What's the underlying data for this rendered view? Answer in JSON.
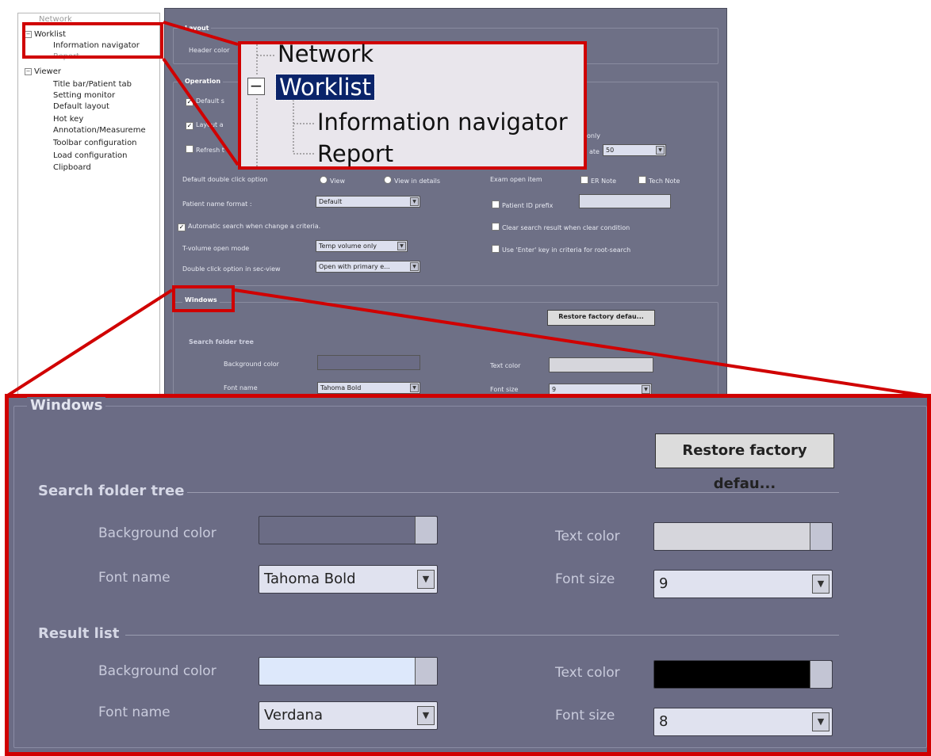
{
  "tree": {
    "items": [
      {
        "label": "Network"
      },
      {
        "label": "Worklist"
      },
      {
        "label": "Information navigator"
      },
      {
        "label": "Report"
      },
      {
        "label": "Viewer"
      },
      {
        "label": "Title bar/Patient tab"
      },
      {
        "label": "Setting monitor"
      },
      {
        "label": "Default layout"
      },
      {
        "label": "Hot key"
      },
      {
        "label": "Annotation/Measureme"
      },
      {
        "label": "Toolbar configuration"
      },
      {
        "label": "Load configuration"
      },
      {
        "label": "Clipboard"
      }
    ],
    "expand_minus": "−"
  },
  "settings": {
    "layout_group": "Layout",
    "header_color_label": "Header color",
    "operation_group": "Operation",
    "default_label": "Default s",
    "layout_label": "Layout a",
    "refresh_label": "Refresh t",
    "only_text": "only",
    "rate_label": "ate",
    "rate_value": "50",
    "dbl_click_label": "Default double click option",
    "view_option": "View",
    "view_detail_option": "View in details",
    "exam_open_label": "Exam open item",
    "er_note": "ER Note",
    "tech_note": "Tech Note",
    "patient_name_label": "Patient name format :",
    "patient_name_value": "Default",
    "patient_id_prefix": "Patient ID prefix",
    "auto_search": "Automatic search when change a criteria.",
    "clear_search": "Clear search result when clear condition",
    "tvolume_label": "T-volume open mode",
    "tvolume_value": "Temp volume only",
    "use_enter": "Use 'Enter' key in criteria for root-search",
    "dbl_secview_label": "Double click option in sec-view",
    "dbl_secview_value": "Open with primary e...",
    "windows_group": "Windows",
    "restore_btn": "Restore factory defau...",
    "search_folder_tree": "Search folder tree",
    "background_color": "Background color",
    "text_color": "Text color",
    "font_name": "Font name",
    "font_name_value": "Tahoma Bold",
    "font_size": "Font size",
    "font_size_value": "9",
    "checkmark": "✓",
    "arrow": "▼"
  },
  "zoom_tree": {
    "network": "Network",
    "worklist": "Worklist",
    "info_nav": "Information navigator",
    "report": "Report",
    "minus": "−"
  },
  "windows": {
    "title": "Windows",
    "restore_btn": "Restore factory defau...",
    "search_folder_tree": {
      "heading": "Search folder tree",
      "background_color_label": "Background color",
      "background_color": "#6b6c85",
      "text_color_label": "Text color",
      "text_color": "#d6d6dc",
      "font_name_label": "Font name",
      "font_name_value": "Tahoma Bold",
      "font_size_label": "Font size",
      "font_size_value": "9"
    },
    "result_list": {
      "heading": "Result list",
      "background_color_label": "Background color",
      "background_color": "#dde8fb",
      "text_color_label": "Text color",
      "text_color": "#000000",
      "font_name_label": "Font name",
      "font_name_value": "Verdana",
      "font_size_label": "Font size",
      "font_size_value": "8"
    },
    "arrow": "▼"
  },
  "colors": {
    "highlight": "#d00000",
    "panel_bg": "#6b6c85",
    "selection": "#0a246a"
  }
}
